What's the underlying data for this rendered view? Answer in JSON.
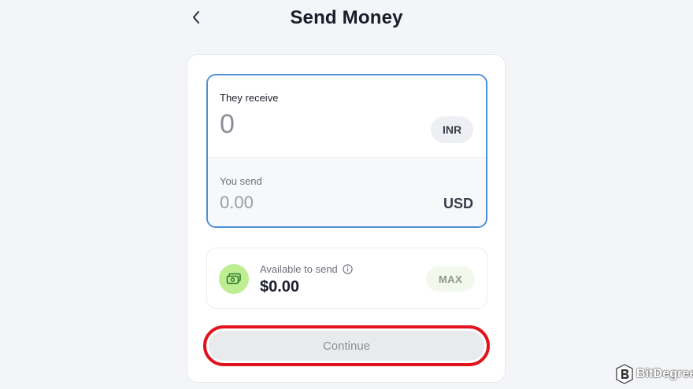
{
  "header": {
    "back_icon": "chevron-left-icon",
    "title": "Send Money"
  },
  "exchange": {
    "receive_label": "They receive",
    "receive_value": "0",
    "receive_currency": "INR",
    "send_label": "You send",
    "send_value": "0.00",
    "send_currency": "USD"
  },
  "available": {
    "icon": "cash-icon",
    "label": "Available to send",
    "info_icon": "info-icon",
    "amount": "$0.00",
    "max_label": "MAX"
  },
  "actions": {
    "continue_label": "Continue"
  },
  "watermark": {
    "brand": "BitDegree"
  },
  "colors": {
    "accent_border": "#4c8fd6",
    "highlight_ring": "#e1141d",
    "cash_icon_bg": "#bfee92"
  }
}
